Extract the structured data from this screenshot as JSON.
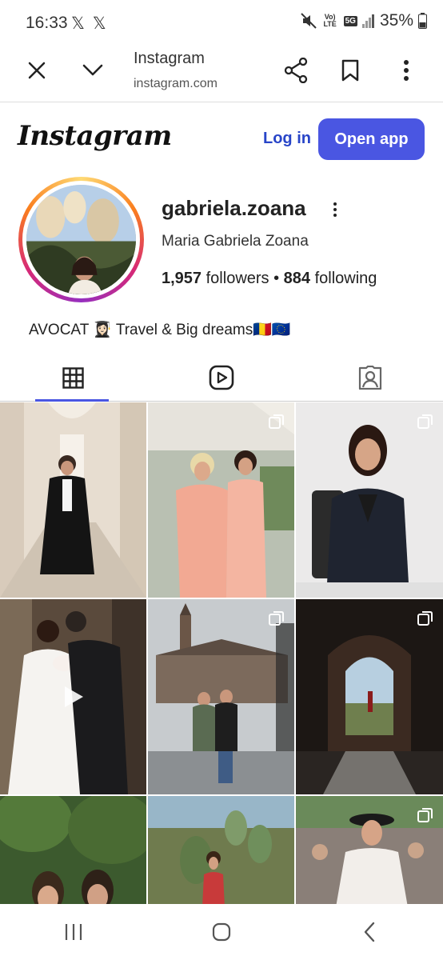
{
  "status_bar": {
    "time": "16:33",
    "x_icons": "𝕏 𝕏",
    "network_label": "Vo) LTE",
    "network_5g": "5G",
    "battery": "35%"
  },
  "browser": {
    "page_title": "Instagram",
    "url": "instagram.com"
  },
  "header": {
    "logo_text": "Instagram",
    "login_label": "Log in",
    "open_app_label": "Open app"
  },
  "profile": {
    "username": "gabriela.zoana",
    "full_name": "Maria Gabriela Zoana",
    "followers_count": "1,957",
    "followers_label": "followers",
    "following_count": "884",
    "following_label": "following",
    "bio": "AVOCAT 👩🏻‍🎓 Travel & Big dreams🇷🇴🇪🇺"
  },
  "tabs": [
    {
      "name": "posts",
      "icon": "grid-icon",
      "active": true
    },
    {
      "name": "reels",
      "icon": "reels-icon",
      "active": false
    },
    {
      "name": "tagged",
      "icon": "tagged-icon",
      "active": false
    }
  ],
  "posts": [
    {
      "desc": "lawyer in robe in corridor",
      "type": "single"
    },
    {
      "desc": "two women at event",
      "type": "carousel"
    },
    {
      "desc": "woman at desk",
      "type": "carousel"
    },
    {
      "desc": "wedding kiss",
      "type": "reel"
    },
    {
      "desc": "peace palace",
      "type": "carousel"
    },
    {
      "desc": "archway silhouette",
      "type": "carousel"
    },
    {
      "desc": "two women outdoors",
      "type": "single"
    },
    {
      "desc": "cactus garden",
      "type": "single"
    },
    {
      "desc": "woman in hat",
      "type": "carousel"
    }
  ],
  "colors": {
    "accent": "#4a56e2",
    "link": "#2845c8"
  }
}
